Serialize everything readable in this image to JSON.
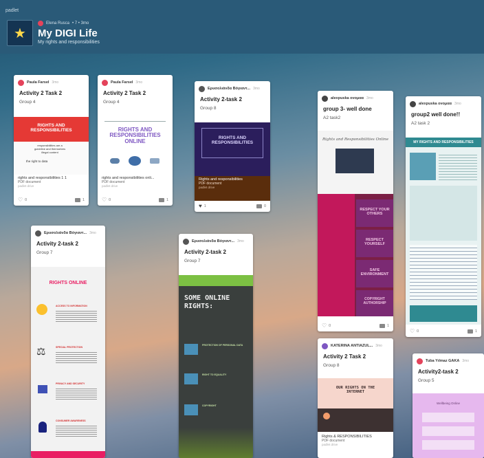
{
  "app": {
    "brand": "padlet"
  },
  "board": {
    "author": "Elena Rusca",
    "meta": "• 7 • 3mo",
    "title": "My DIGI Life",
    "subtitle": "My rights and responsibilities"
  },
  "cards": [
    {
      "author": "Paula Farsel",
      "time": "3mo",
      "title": "Activity 2 Task 2",
      "text": "Group 4",
      "poster_title": "RIGHTS AND RESPONSIBILITIES",
      "poster_line1": "responsibilities are a guideline and themselves illegal content",
      "poster_line2": "the right to data",
      "att_name": "rights and responsibilities 1 1",
      "att_type": "PDF document",
      "att_src": "padlet drive",
      "likes": "0",
      "comments": "1"
    },
    {
      "author": "Paula Farsel",
      "time": "3mo",
      "title": "Activity 2 Task 2",
      "text": "Group 4",
      "poster_title": "RIGHTS AND RESPONSIBILITIES ONLINE",
      "att_name": "rights and responsibilities onli...",
      "att_type": "PDF document",
      "att_src": "padlet drive",
      "likes": "0",
      "comments": "1"
    },
    {
      "author": "Ερυσολιάνδα Βόγιαντ...",
      "time": "3mo",
      "title": "Activity 2-task 2",
      "text": "Group 8",
      "poster_title": "RIGHTS AND RESPONSIBILITIES",
      "att_name": "Rights and responsibilities",
      "att_type": "PDF document",
      "att_src": "padlet drive",
      "likes": "1",
      "comments": "0"
    },
    {
      "author": "alexpuska ονομαα",
      "time": "3mo",
      "title": "group 3- well done",
      "text": "A2 task2",
      "poster_title": "Rights and Responsibilities Online",
      "tiles": [
        "RESPECT YOUR OTHERS",
        "RESPECT YOURSELF",
        "SAFE ENVIRONMENT",
        "COPYRIGHT AUTHORSHIP"
      ],
      "likes": "0",
      "comments": "1"
    },
    {
      "author": "alexpuska ονομαα",
      "time": "3mo",
      "title": "group2 well done!!",
      "text": "A2 task 2",
      "poster_title": "MY RIGHTS AND RESPONSIBILITIES",
      "likes": "0",
      "comments": "1"
    },
    {
      "author": "Ερυσολιάνδα Βόγιαντ...",
      "time": "3mo",
      "title": "Activity 2-task 2",
      "text": "Group 7",
      "poster_title": "RIGHTS ONLINE",
      "sections": [
        "ACCESS TO INFORMATION",
        "SPECIAL PROTECTION",
        "PRIVACY AND SECURITY",
        "CONSUMER AWARENESS"
      ]
    },
    {
      "author": "Ερυσολιάνδα Βόγιαντ...",
      "time": "3mo",
      "title": "Activity 2-task 2",
      "text": "Group 7",
      "poster_title": "SOME ONLINE RIGHTS:",
      "rows": [
        "PROTECTION OF PERSONAL DATA",
        "RIGHT TO EQUALITY",
        "COPYRIGHT"
      ]
    },
    {
      "author": "KATERINA ANTIAZUL...",
      "time": "3mo",
      "title": "Activity 2  Task 2",
      "text": "Group 8",
      "poster_title": "OUR RIGHTS ON THE INTERNET",
      "att_name": "Rights & RESPONSIBILITIES",
      "att_type": "PDF document",
      "att_src": "padlet drive"
    },
    {
      "author": "Tuba Yılmaz GAKA",
      "time": "3mo",
      "title": "Activity2-task 2",
      "text": "Group 5",
      "poster_title": "Wellbeing Online"
    }
  ]
}
